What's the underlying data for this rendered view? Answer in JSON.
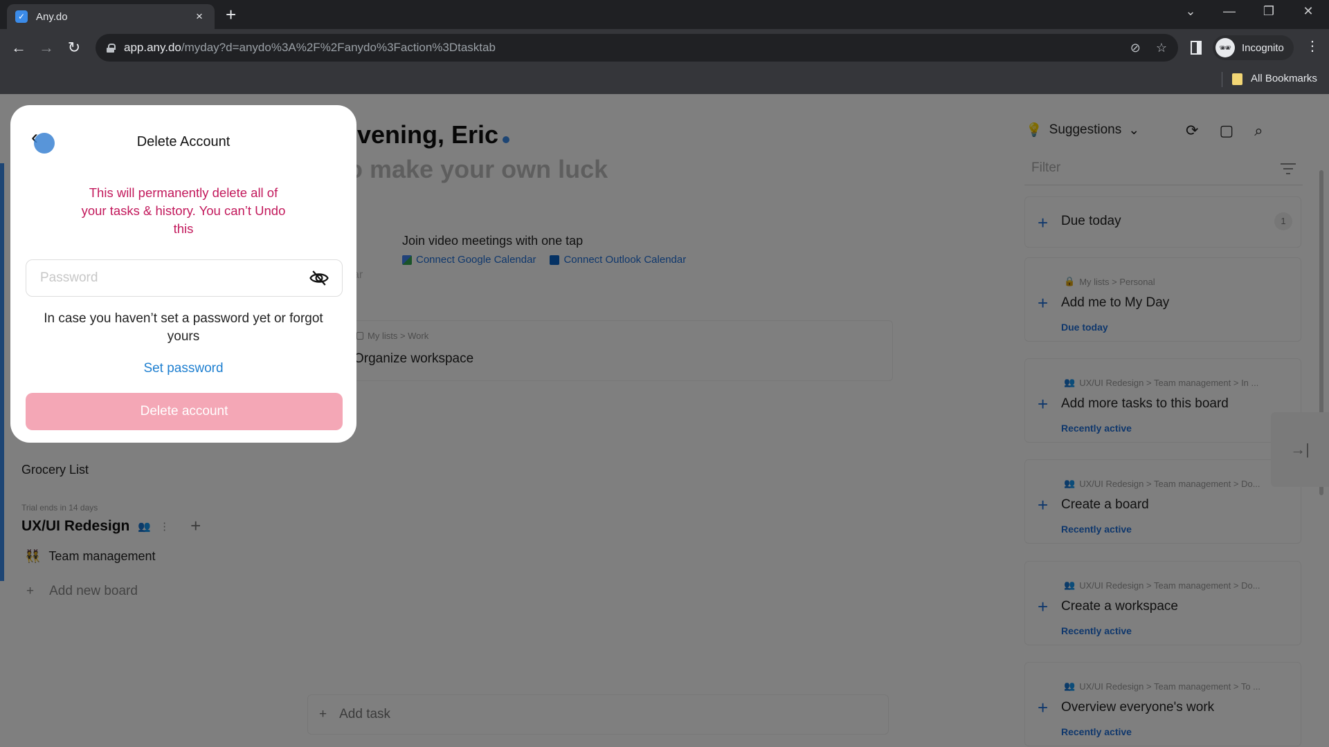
{
  "browser": {
    "tab_title": "Any.do",
    "tab_close": "×",
    "new_tab": "+",
    "url_host": "app.any.do",
    "url_path": "/myday?d=anydo%3A%2F%2Fanydo%3Faction%3Dtasktab",
    "profile_label": "Incognito",
    "bookmarks_label": "All Bookmarks",
    "icons": {
      "back": "←",
      "forward": "→",
      "reload": "↻",
      "eye_off": "⊘",
      "star": "☆",
      "menu": "⋮",
      "tab_search": "⌄",
      "minimize": "—",
      "restore": "❐",
      "close": "✕",
      "incognito": "🕶"
    }
  },
  "main": {
    "greeting": "d Evening, Eric",
    "tagline": "e to make your own luck",
    "video_meetings": {
      "title": "Join video meetings with one tap",
      "google_link": "Connect Google Calendar",
      "outlook_link": "Connect Outlook Calendar",
      "partial_hint": "ar"
    },
    "task": {
      "path": "My lists > Work",
      "title": "Organize workspace"
    },
    "add_task_placeholder": "Add task"
  },
  "sidebar": {
    "grocery_list": "Grocery List",
    "trial_notice": "Trial ends in 14 days",
    "workspace_name": "UX/UI Redesign",
    "board_emoji": "👯",
    "board_name": "Team management",
    "add_board": "Add new board"
  },
  "suggestions": {
    "header_label": "Suggestions",
    "filter_placeholder": "Filter",
    "due_today": {
      "label": "Due today",
      "count": "1"
    },
    "items": [
      {
        "path": "My lists > Personal",
        "title": "Add me to My Day",
        "tag": "Due today",
        "path_icon": "lock"
      },
      {
        "path": "UX/UI Redesign > Team management > In ...",
        "title": "Add more tasks to this board",
        "tag": "Recently active",
        "path_icon": "people"
      },
      {
        "path": "UX/UI Redesign > Team management > Do...",
        "title": "Create a board",
        "tag": "Recently active",
        "path_icon": "people"
      },
      {
        "path": "UX/UI Redesign > Team management > Do...",
        "title": "Create a workspace",
        "tag": "Recently active",
        "path_icon": "people"
      },
      {
        "path": "UX/UI Redesign > Team management > To ...",
        "title": "Overview everyone's work",
        "tag": "Recently active",
        "path_icon": "people"
      }
    ],
    "collapse_icon": "→|"
  },
  "modal": {
    "title": "Delete Account",
    "warning": "This will permanently delete all of your tasks & history. You can’t Undo this",
    "password_placeholder": "Password",
    "password_value": "",
    "help_text": "In case you haven’t set a password yet or forgot yours",
    "set_password_link": "Set password",
    "delete_button": "Delete account"
  },
  "colors": {
    "accent_blue": "#1e6fd9",
    "warning_red": "#c2185b",
    "delete_button_disabled": "#f4a7b6"
  }
}
